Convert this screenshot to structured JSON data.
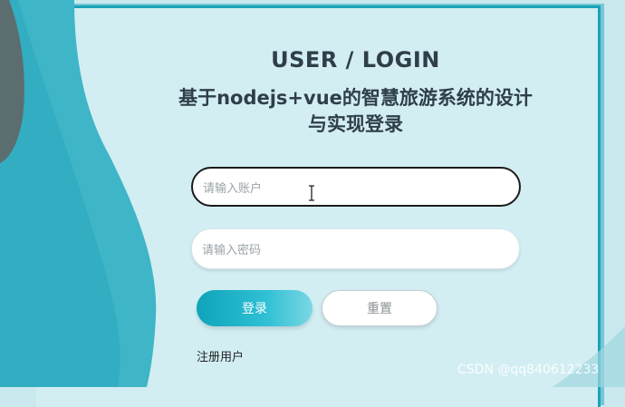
{
  "login": {
    "title": "USER / LOGIN",
    "subtitle_line1": "基于nodejs+vue的智慧旅游系统的设计",
    "subtitle_line2": "与实现登录",
    "account_placeholder": "请输入账户",
    "password_placeholder": "请输入密码",
    "login_button": "登录",
    "reset_button": "重置",
    "register_link": "注册用户"
  },
  "watermark": "CSDN @qq840612233",
  "colors": {
    "accent": "#1aa3b9",
    "background": "#c9e9ef",
    "panel": "#d2eef3",
    "title_text": "#2f3e4a"
  }
}
